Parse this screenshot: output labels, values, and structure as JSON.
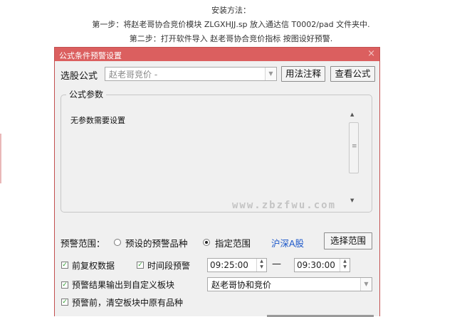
{
  "instructions": {
    "title": "安装方法：",
    "step1": "第一步：将赵老哥协合竞价模块  ZLGXHJJ.sp 放入通达信  T0002/pad 文件夹中.",
    "step2": "第二步：打开软件导入  赵老哥协合竞价指标  按图设好预警."
  },
  "dialog": {
    "title": "公式条件预警设置",
    "close_glyph": "×",
    "select_formula_label": "选股公式",
    "formula_value": "赵老哥竞价    -",
    "usage_button": "用法注释",
    "view_button": "查看公式",
    "params_group_title": "公式参数",
    "no_params_text": "无参数需要设置",
    "watermark": "www.zbzfwu.com",
    "alert_range_label": "预警范围：",
    "option_preset": "预设的预警品种",
    "option_specified": "指定范围",
    "selected_option": "指定范围",
    "market_link": "沪深A股",
    "select_range_button": "选择范围",
    "chk_fuquan": "前复权数据",
    "chk_time_alert": "时间段预警",
    "time_start": "09:25:00",
    "time_end": "09:30:00",
    "time_separator": "—",
    "chk_output_block": "预警结果输出到自定义板块",
    "block_value": "赵老哥协和竞价",
    "chk_clear_block": "预警前，清空板块中原有品种",
    "check_glyph": "☑"
  },
  "colors": {
    "titlebar": "#db5f5f",
    "link": "#1a56c9",
    "check": "#2e9e2e"
  },
  "icons": {
    "close": "close-icon",
    "dropdown": "chevron-down-icon",
    "scroll_up": "arrow-up-icon",
    "scroll_down": "arrow-down-icon"
  }
}
